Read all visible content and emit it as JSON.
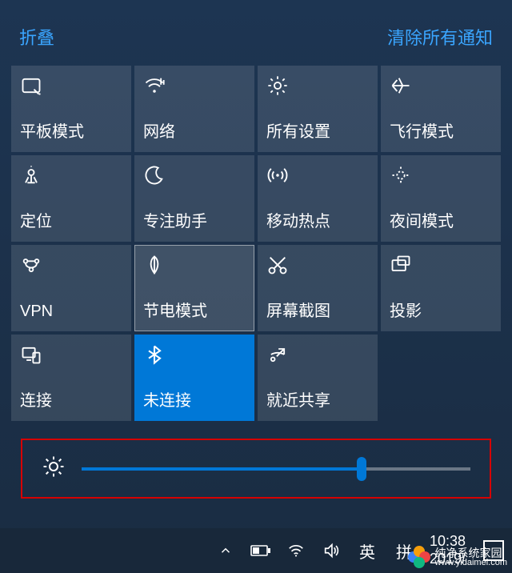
{
  "header": {
    "collapse": "折叠",
    "clear": "清除所有通知"
  },
  "tiles": [
    {
      "id": "tablet-mode",
      "label": "平板模式",
      "icon": "tablet-icon"
    },
    {
      "id": "network",
      "label": "网络",
      "icon": "wifi-icon"
    },
    {
      "id": "all-settings",
      "label": "所有设置",
      "icon": "gear-icon"
    },
    {
      "id": "airplane",
      "label": "飞行模式",
      "icon": "airplane-icon"
    },
    {
      "id": "location",
      "label": "定位",
      "icon": "location-icon"
    },
    {
      "id": "focus-assist",
      "label": "专注助手",
      "icon": "moon-icon"
    },
    {
      "id": "hotspot",
      "label": "移动热点",
      "icon": "hotspot-icon"
    },
    {
      "id": "night-light",
      "label": "夜间模式",
      "icon": "night-light-icon"
    },
    {
      "id": "vpn",
      "label": "VPN",
      "icon": "vpn-icon"
    },
    {
      "id": "battery-saver",
      "label": "节电模式",
      "icon": "leaf-icon",
      "selected": true
    },
    {
      "id": "snip",
      "label": "屏幕截图",
      "icon": "snip-icon"
    },
    {
      "id": "project",
      "label": "投影",
      "icon": "project-icon"
    },
    {
      "id": "connect",
      "label": "连接",
      "icon": "connect-icon"
    },
    {
      "id": "bluetooth",
      "label": "未连接",
      "icon": "bluetooth-icon",
      "active": true
    },
    {
      "id": "near-share",
      "label": "就近共享",
      "icon": "share-icon"
    }
  ],
  "brightness": {
    "value_percent": 72
  },
  "taskbar": {
    "ime1": "英",
    "ime2": "拼",
    "time": "10:38",
    "date": "2019/"
  },
  "watermark": {
    "line1": "纯净系统家园",
    "line2": "www.yidaimei.com"
  }
}
